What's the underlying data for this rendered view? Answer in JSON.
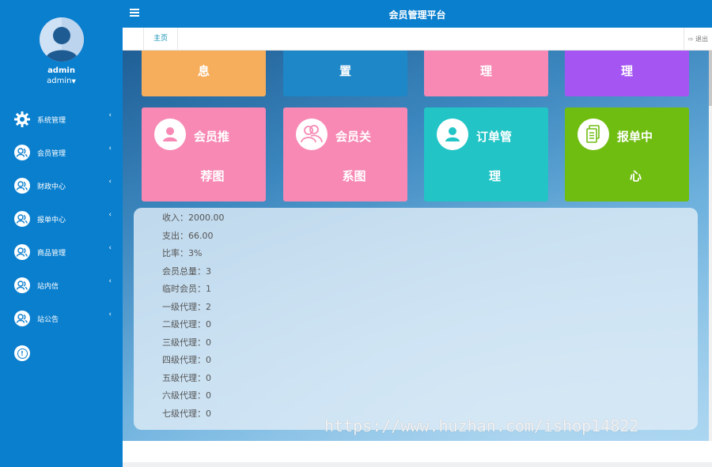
{
  "app": {
    "title": "会员管理平台"
  },
  "user": {
    "name": "admin",
    "role": "admin"
  },
  "sidebar": {
    "items": [
      {
        "label": "系统管理",
        "icon": "gear-icon"
      },
      {
        "label": "会员管理",
        "icon": "user-icon"
      },
      {
        "label": "财政中心",
        "icon": "user-icon"
      },
      {
        "label": "报单中心",
        "icon": "user-icon"
      },
      {
        "label": "商品管理",
        "icon": "user-icon"
      },
      {
        "label": "站内信",
        "icon": "user-icon"
      },
      {
        "label": "站公告",
        "icon": "user-icon"
      }
    ],
    "arrow": "‹",
    "info_glyph": "!"
  },
  "tabs": {
    "home": "主页",
    "logout": "退出"
  },
  "tiles_top": [
    {
      "text": "息",
      "color": "#f7ae5c"
    },
    {
      "text": "置",
      "color": "#1e87c8"
    },
    {
      "text": "理",
      "color": "#f789b4"
    },
    {
      "text": "理",
      "color": "#a556f2"
    }
  ],
  "tiles_main": [
    {
      "line1": "会员推",
      "line2": "荐图",
      "icon": "user-icon",
      "color": "#f789b4"
    },
    {
      "line1": "会员关",
      "line2": "系图",
      "icon": "users-icon",
      "color": "#f789b4"
    },
    {
      "line1": "订单管",
      "line2": "理",
      "icon": "user-icon",
      "color": "#22c4c6"
    },
    {
      "line1": "报单中",
      "line2": "心",
      "icon": "document-icon",
      "color": "#70bd12"
    }
  ],
  "stats": [
    "收入：2000.00",
    "支出：66.00",
    "比率：3%",
    "会员总量：3",
    "临时会员：1",
    "一级代理：2",
    "二级代理：0",
    "三级代理：0",
    "四级代理：0",
    "五级代理：0",
    "六级代理：0",
    "七级代理：0"
  ],
  "watermark": "https://www.huzhan.com/ishop14822",
  "colors": {
    "primary": "#0a7fce",
    "tab_active": "#0a8fb3"
  }
}
